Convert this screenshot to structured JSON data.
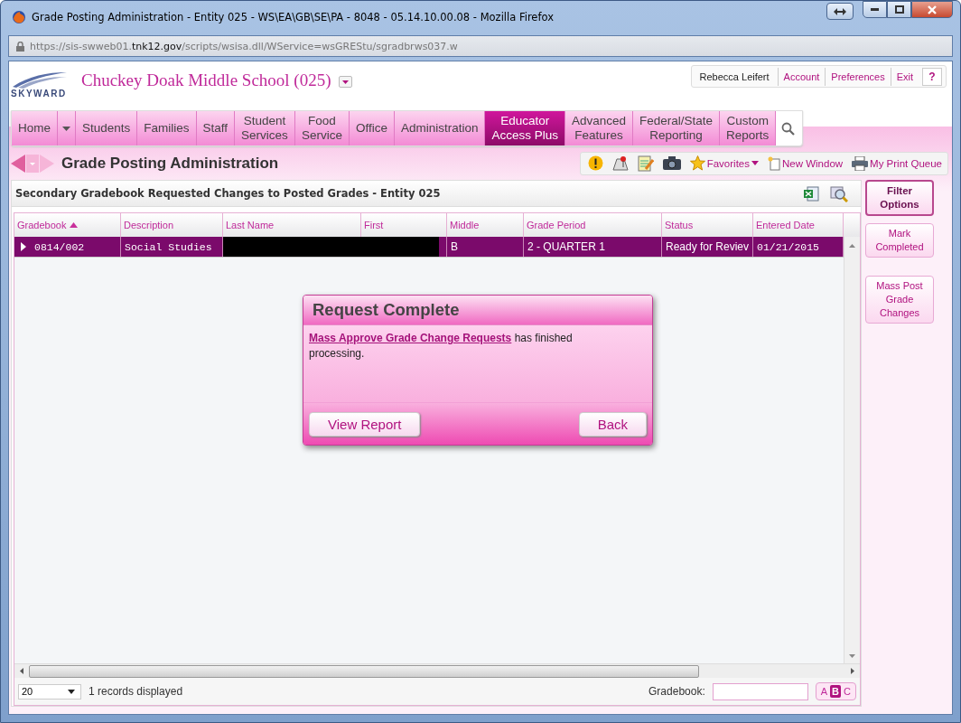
{
  "window": {
    "title": "Grade Posting Administration - Entity 025 - WS\\EA\\GB\\SE\\PA - 8048 - 05.14.10.00.08 - Mozilla Firefox"
  },
  "address_bar": {
    "prefix": "https://sis-swweb01.",
    "domain": "tnk12.gov",
    "path": "/scripts/wsisa.dll/WService=wsGREStu/sgradbrws037.w"
  },
  "header": {
    "logo_text": "SKYWARD",
    "school": "Chuckey Doak Middle School (025)",
    "user": "Rebecca Leifert",
    "links": [
      "Account",
      "Preferences",
      "Exit"
    ],
    "help": "?"
  },
  "nav": [
    {
      "label": [
        "Home"
      ],
      "selected": false
    },
    {
      "label": [
        "Students"
      ],
      "selected": false
    },
    {
      "label": [
        "Families"
      ],
      "selected": false
    },
    {
      "label": [
        "Staff"
      ],
      "selected": false
    },
    {
      "label": [
        "Student",
        "Services"
      ],
      "selected": false
    },
    {
      "label": [
        "Food",
        "Service"
      ],
      "selected": false
    },
    {
      "label": [
        "Office"
      ],
      "selected": false
    },
    {
      "label": [
        "Administration"
      ],
      "selected": false
    },
    {
      "label": [
        "Educator",
        "Access Plus"
      ],
      "selected": true
    },
    {
      "label": [
        "Advanced",
        "Features"
      ],
      "selected": false
    },
    {
      "label": [
        "Federal/State",
        "Reporting"
      ],
      "selected": false
    },
    {
      "label": [
        "Custom",
        "Reports"
      ],
      "selected": false
    }
  ],
  "page_title": "Grade Posting Administration",
  "toolbar": {
    "favorites": "Favorites",
    "new_window": "New Window",
    "print_queue": "My Print Queue"
  },
  "grid": {
    "title": "Secondary Gradebook Requested Changes to Posted Grades - Entity 025",
    "columns": [
      {
        "label": "Gradebook",
        "sorted": true
      },
      {
        "label": "Description",
        "sorted": false
      },
      {
        "label": "Last Name",
        "sorted": false
      },
      {
        "label": "First",
        "sorted": false
      },
      {
        "label": "Middle",
        "sorted": false
      },
      {
        "label": "Grade Period",
        "sorted": false
      },
      {
        "label": "Status",
        "sorted": false
      },
      {
        "label": "Entered Date",
        "sorted": false
      }
    ],
    "rows": [
      {
        "selected": true,
        "expanded": false,
        "redacted": true,
        "gradebook": "0814/002",
        "description": "Social Studies",
        "middle": "B",
        "grade_period": "2 - QUARTER 1",
        "status": "Ready for Reviev",
        "entered_date": "01/21/2015"
      }
    ],
    "page_size": "20",
    "records": "1 records displayed",
    "search_label": "Gradebook:",
    "letters": [
      {
        "label": "A",
        "selected": false
      },
      {
        "label": "B",
        "selected": true
      },
      {
        "label": "C",
        "selected": false
      }
    ]
  },
  "side_buttons": [
    {
      "label": [
        "Filter",
        "Options"
      ],
      "kind": "primary"
    },
    {
      "label": [
        "Mark",
        "Completed"
      ],
      "kind": "secondary"
    },
    {
      "label": [
        "Mass Post",
        "Grade",
        "Changes"
      ],
      "kind": "secondary"
    }
  ],
  "dialog": {
    "title": "Request Complete",
    "link": "Mass Approve Grade Change Requests",
    "message": " has finished processing.",
    "buttons": [
      "View Report",
      "Back"
    ]
  }
}
